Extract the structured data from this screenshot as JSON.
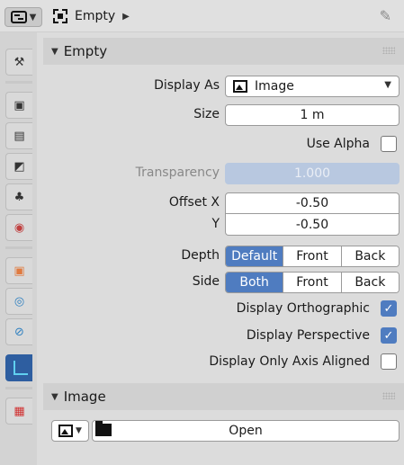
{
  "header": {
    "breadcrumb": "Empty",
    "editor_icon": "properties-editor-icon",
    "pin_icon": "pin-icon"
  },
  "tabs": [
    {
      "name": "tool-tab",
      "icon": "tool-icon",
      "glyph": "⚒"
    },
    {
      "name": "render-tab",
      "icon": "render-icon",
      "glyph": "▣"
    },
    {
      "name": "output-tab",
      "icon": "output-icon",
      "glyph": "▤"
    },
    {
      "name": "view-layer-tab",
      "icon": "view-layer-icon",
      "glyph": "◩"
    },
    {
      "name": "scene-tab",
      "icon": "scene-icon",
      "glyph": "♣"
    },
    {
      "name": "world-tab",
      "icon": "world-icon",
      "glyph": "◉"
    },
    {
      "name": "object-tab",
      "icon": "object-icon",
      "glyph": "▣"
    },
    {
      "name": "physics-tab",
      "icon": "physics-icon",
      "glyph": "◎"
    },
    {
      "name": "constraints-tab",
      "icon": "constraints-icon",
      "glyph": "⊘"
    },
    {
      "name": "object-data-tab",
      "icon": "empty-data-icon",
      "glyph": ""
    },
    {
      "name": "texture-tab",
      "icon": "texture-icon",
      "glyph": "▦"
    }
  ],
  "empty_panel": {
    "title": "Empty",
    "display_as_label": "Display As",
    "display_as_value": "Image",
    "size_label": "Size",
    "size_value": "1 m",
    "use_alpha_label": "Use Alpha",
    "use_alpha_checked": false,
    "transparency_label": "Transparency",
    "transparency_value": "1.000",
    "offset_x_label": "Offset X",
    "offset_x_value": "-0.50",
    "offset_y_label": "Y",
    "offset_y_value": "-0.50",
    "depth_label": "Depth",
    "depth_options": [
      "Default",
      "Front",
      "Back"
    ],
    "depth_selected": "Default",
    "side_label": "Side",
    "side_options": [
      "Both",
      "Front",
      "Back"
    ],
    "side_selected": "Both",
    "display_orthographic_label": "Display Orthographic",
    "display_orthographic_checked": true,
    "display_perspective_label": "Display Perspective",
    "display_perspective_checked": true,
    "display_only_axis_aligned_label": "Display Only Axis Aligned",
    "display_only_axis_aligned_checked": false
  },
  "image_panel": {
    "title": "Image",
    "open_label": "Open"
  },
  "colors": {
    "accent": "#4f7cc0",
    "active_tab": "#2e5ea0"
  }
}
